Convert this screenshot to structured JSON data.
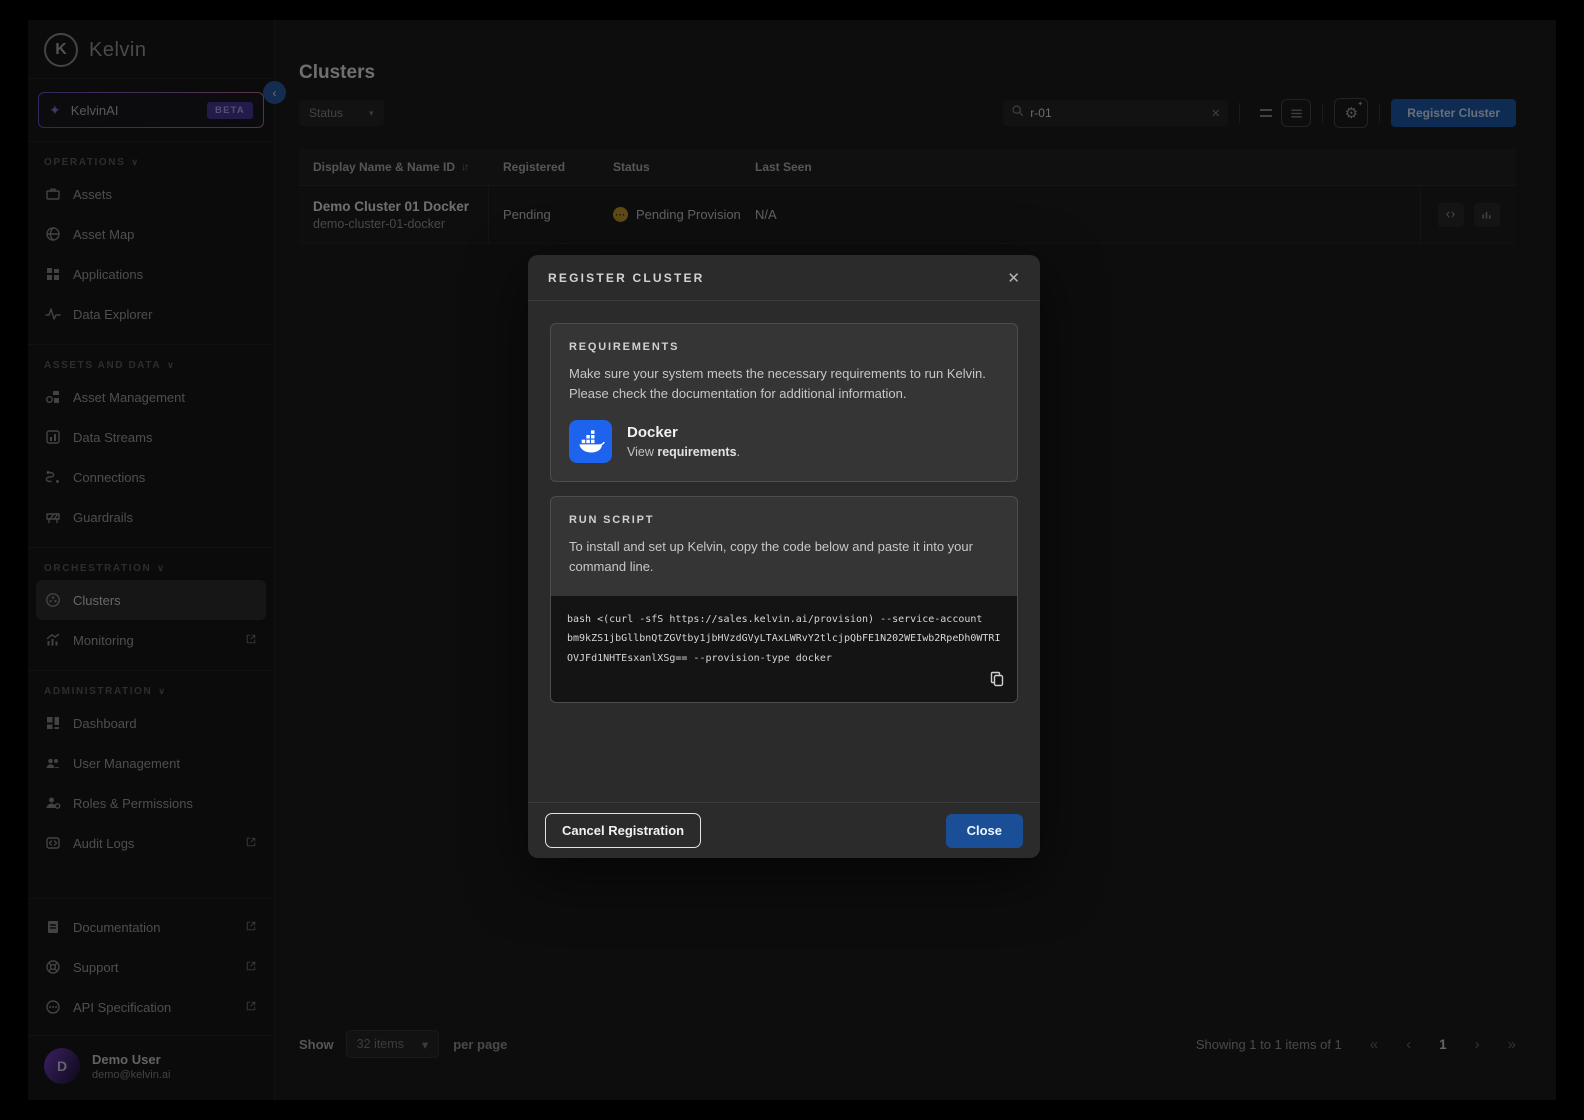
{
  "brand": {
    "name": "Kelvin",
    "logo_letter": "K"
  },
  "sidebar": {
    "ai": {
      "label": "KelvinAI",
      "badge": "BETA"
    },
    "sections": [
      {
        "label": "OPERATIONS",
        "items": [
          "Assets",
          "Asset Map",
          "Applications",
          "Data Explorer"
        ]
      },
      {
        "label": "ASSETS AND DATA",
        "items": [
          "Asset Management",
          "Data Streams",
          "Connections",
          "Guardrails"
        ]
      },
      {
        "label": "ORCHESTRATION",
        "items": [
          "Clusters",
          "Monitoring"
        ]
      },
      {
        "label": "ADMINISTRATION",
        "items": [
          "Dashboard",
          "User Management",
          "Roles & Permissions",
          "Audit Logs"
        ]
      }
    ],
    "footer_items": [
      "Documentation",
      "Support",
      "API Specification"
    ],
    "user": {
      "initial": "D",
      "name": "Demo User",
      "email": "demo@kelvin.ai"
    }
  },
  "header": {
    "title": "Clusters",
    "status_filter": "Status",
    "search_value": "r-01",
    "register": "Register Cluster"
  },
  "table": {
    "columns": [
      "Display Name & Name ID",
      "Registered",
      "Status",
      "Last Seen"
    ],
    "row": {
      "name": "Demo Cluster 01 Docker",
      "id": "demo-cluster-01-docker",
      "registered": "Pending",
      "status": "Pending Provision",
      "last_seen": "N/A"
    }
  },
  "footer": {
    "show": "Show",
    "page_size": "32 items",
    "per_page": "per page",
    "summary": "Showing 1 to 1 items of 1",
    "page": "1"
  },
  "modal": {
    "title": "REGISTER CLUSTER",
    "requirements": {
      "heading": "REQUIREMENTS",
      "body": "Make sure your system meets the necessary requirements to run Kelvin. Please check the documentation for additional information.",
      "tool_name": "Docker",
      "link_prefix": "View ",
      "link_bold": "requirements",
      "link_suffix": "."
    },
    "run_script": {
      "heading": "RUN SCRIPT",
      "body": "To install and set up Kelvin, copy the code below and paste it into your command line.",
      "code": "bash <(curl -sfS https://sales.kelvin.ai/provision) --service-account bm9kZS1jbGllbnQtZGVtby1jbHVzdGVyLTAxLWRvY2tlcjpQbFE1N202WEIwb2RpeDh0WTRIOVJFd1NHTEsxanlXSg== --provision-type docker"
    },
    "cancel_button": "Cancel Registration",
    "close_button": "Close"
  },
  "colors": {
    "docker_blue": "#1D63ED",
    "accent_blue": "#1A4F97",
    "status_amber": "#C79B31",
    "beta_purple": "#4A3A99"
  }
}
